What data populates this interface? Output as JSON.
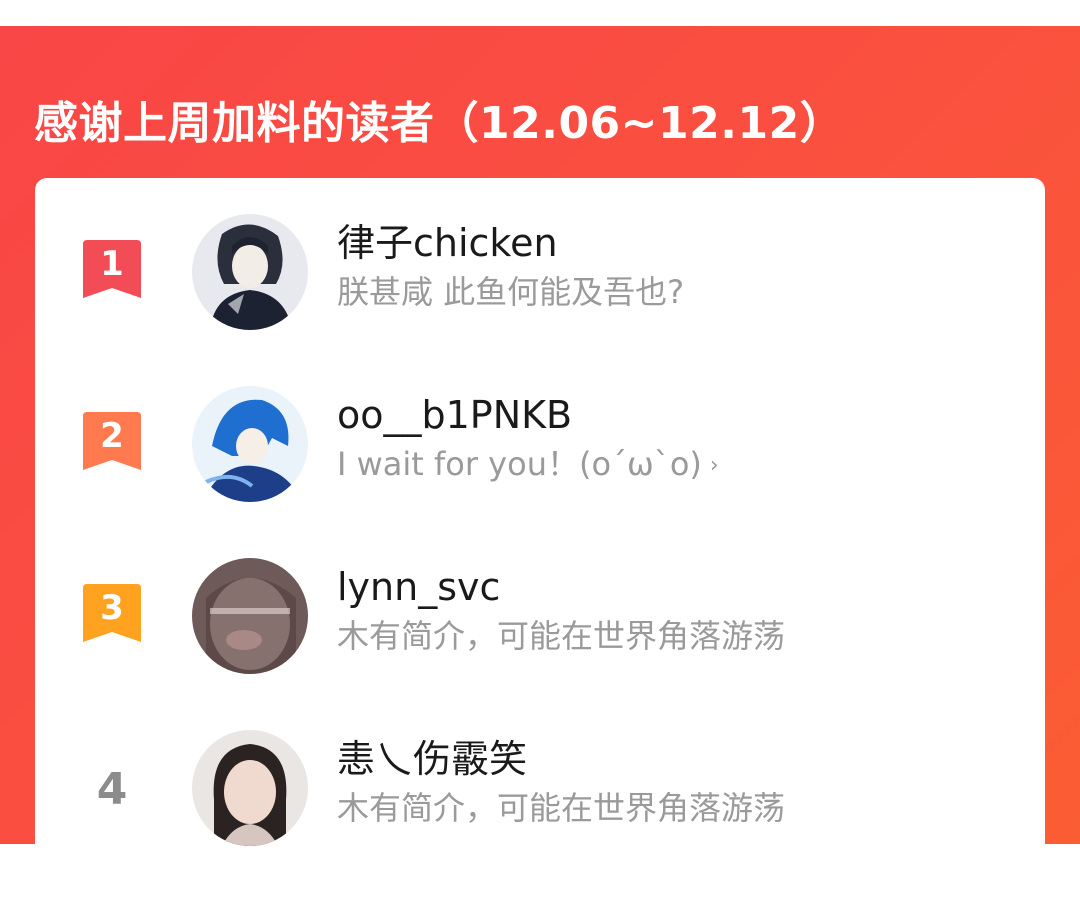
{
  "header": {
    "title": "感谢上周加料的读者（12.06~12.12）"
  },
  "readers": [
    {
      "rank": "1",
      "rank_color": "#f24d57",
      "name": "律子chicken",
      "bio": "朕甚咸 此鱼何能及吾也?"
    },
    {
      "rank": "2",
      "rank_color": "#ff7b4f",
      "name": "oo__b1PNKB",
      "bio": "I wait for you！(o´ω`o)",
      "bio_icon": "chevron-right-icon"
    },
    {
      "rank": "3",
      "rank_color": "#ffa21f",
      "name": "lynn_svc",
      "bio": "木有简介，可能在世界角落游荡"
    },
    {
      "rank": "4",
      "rank_color": "#8c8c8c",
      "name": "恚乀伤霰笑",
      "bio": "木有简介，可能在世界角落游荡"
    }
  ]
}
